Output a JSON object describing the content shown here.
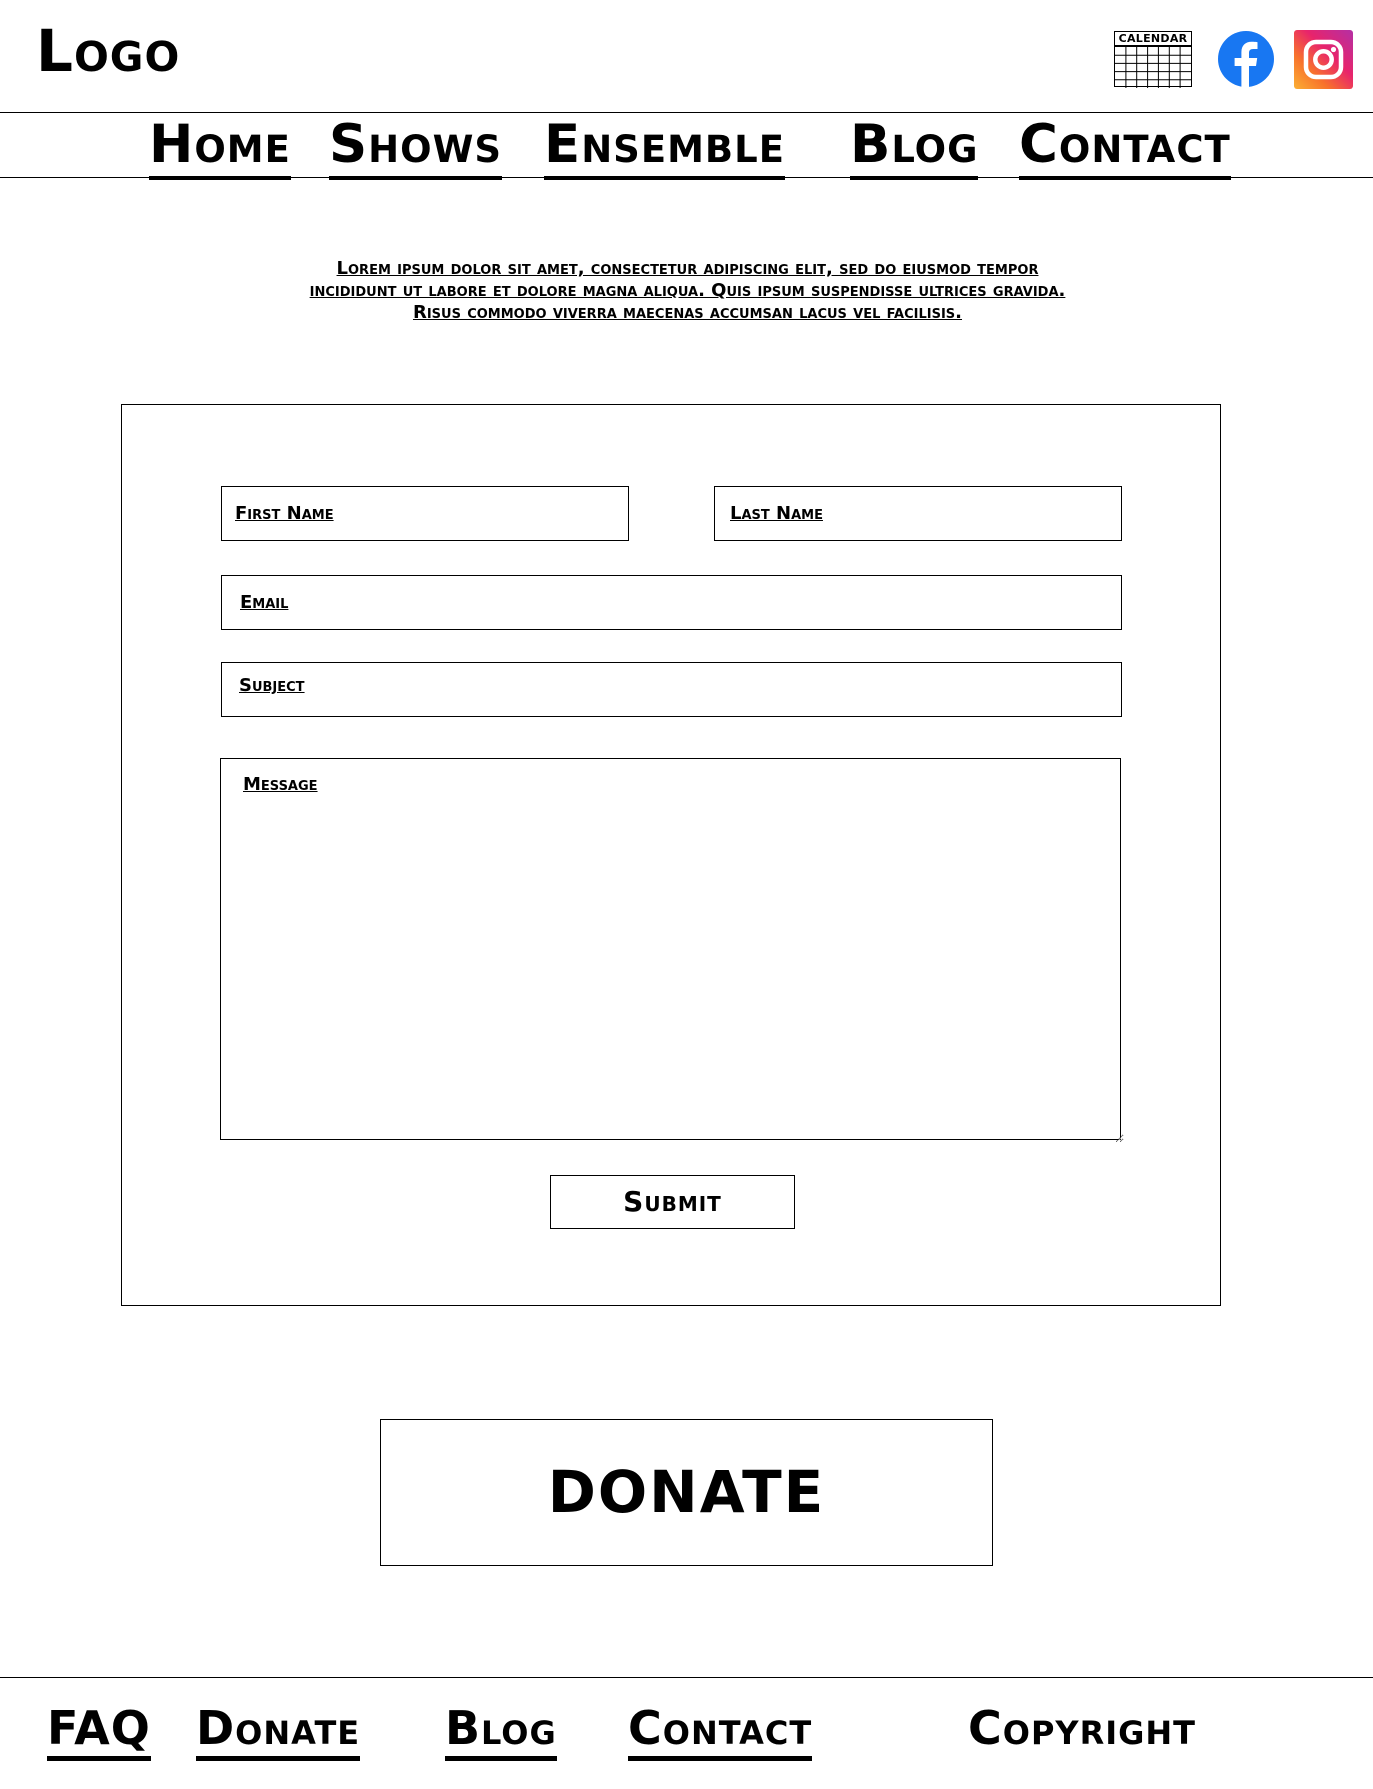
{
  "header": {
    "logo": "Logo",
    "calendar_label": "CALENDAR",
    "social": [
      "facebook-icon",
      "instagram-icon"
    ]
  },
  "nav": {
    "items": [
      "Home",
      "Shows",
      "Ensemble",
      "Blog",
      "Contact"
    ]
  },
  "intro": {
    "line1": "Lorem ipsum dolor sit amet, consectetur adipiscing elit, sed do eiusmod tempor",
    "line2": "incididunt ut labore et dolore magna aliqua. Quis ipsum suspendisse ultrices gravida.",
    "line3": "Risus commodo viverra maecenas accumsan lacus vel facilisis."
  },
  "form": {
    "first_name_label": "First Name",
    "last_name_label": "Last Name",
    "email_label": "Email",
    "subject_label": "Subject",
    "message_label": "Message",
    "submit_label": "Submit"
  },
  "donate_label": "DONATE",
  "footer": {
    "items": [
      "FAQ",
      "Donate",
      "Blog",
      "Contact"
    ],
    "copyright": "Copyright"
  },
  "colors": {
    "facebook": "#1877f2",
    "instagram_gradient": [
      "#fbb033",
      "#f8722c",
      "#e8246b",
      "#b42fa5"
    ]
  }
}
